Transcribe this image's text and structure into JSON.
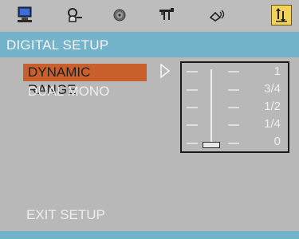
{
  "tabs": [
    {
      "icon": "computer-icon",
      "active": false
    },
    {
      "icon": "audio-person-icon",
      "active": false
    },
    {
      "icon": "disc-icon",
      "active": false
    },
    {
      "icon": "speaker-setup-icon",
      "active": false
    },
    {
      "icon": "speaker-sound-icon",
      "active": false
    },
    {
      "icon": "digital-setup-icon",
      "active": true
    }
  ],
  "title": "DIGITAL SETUP",
  "menu": {
    "items": [
      {
        "label": "DYNAMIC RANGE",
        "selected": true
      },
      {
        "label": "DUAL MONO",
        "selected": false
      }
    ],
    "exit_label": "EXIT SETUP"
  },
  "slider": {
    "labels": [
      "1",
      "3/4",
      "1/2",
      "1/4",
      "0"
    ],
    "value": 0
  },
  "colors": {
    "background": "#b8b8b8",
    "bar": "#73b4cb",
    "highlight": "#c9602c",
    "active_tab": "#f3d25a"
  }
}
